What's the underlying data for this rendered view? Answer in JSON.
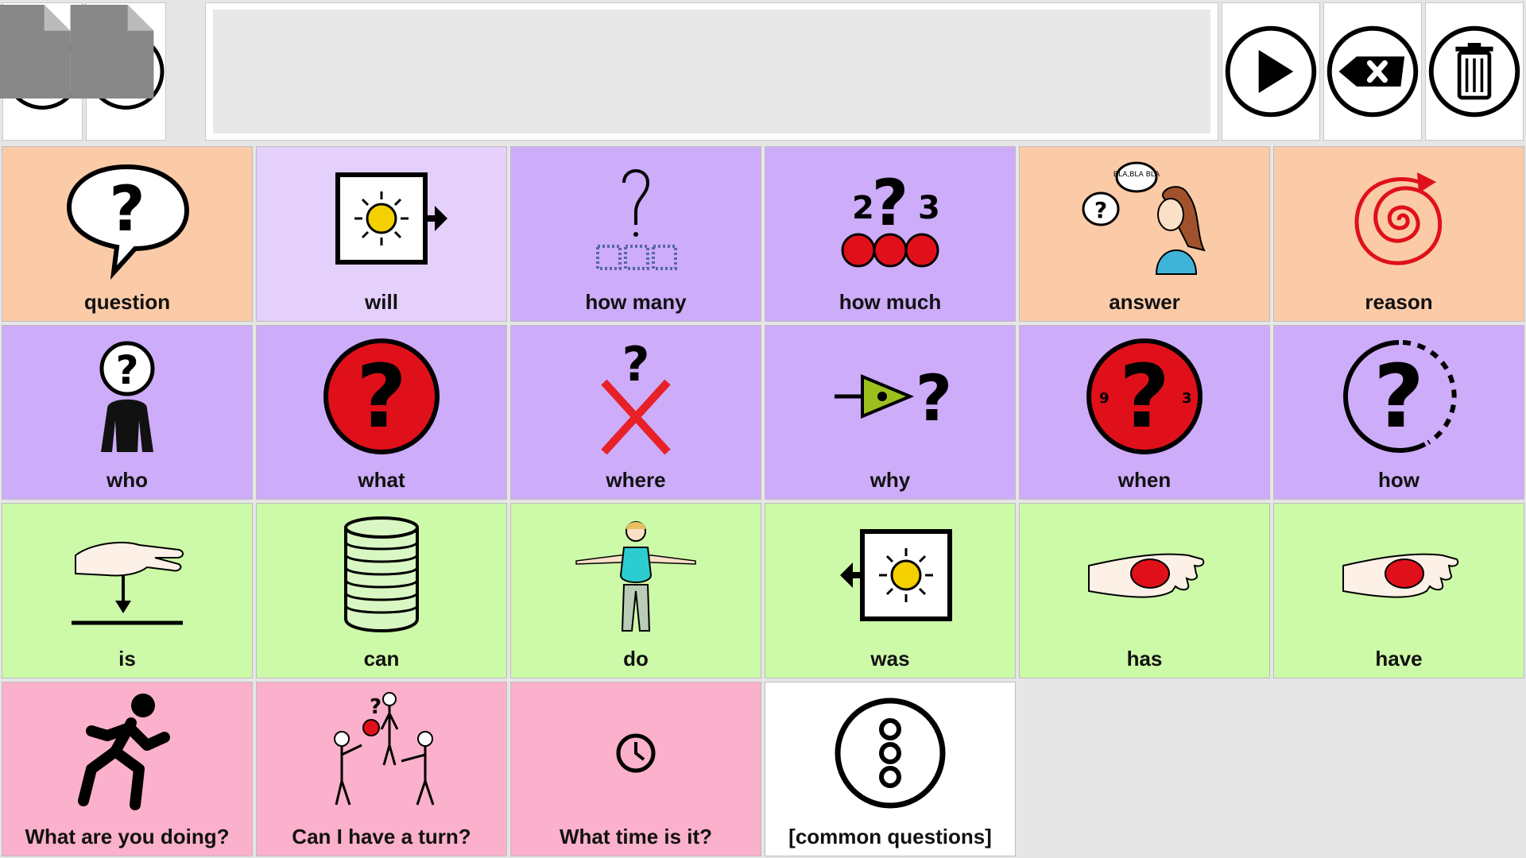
{
  "toolbar": {
    "home_icon": "home-icon",
    "back_icon": "undo-icon",
    "speak_icon": "play-icon",
    "backspace_icon": "backspace-icon",
    "clear_icon": "trash-icon",
    "message_text": ""
  },
  "colors": {
    "peach": "#fbcba8",
    "lavender_light": "#e4d0fb",
    "purple": "#cdacf9",
    "green": "#cdfaa8",
    "pink": "#fbb0cc",
    "white": "#ffffff"
  },
  "cells": [
    {
      "label": "question",
      "icon": "speech-bubble-question-icon",
      "color": "peach"
    },
    {
      "label": "will",
      "icon": "sun-arrow-right-icon",
      "color": "lavender_light"
    },
    {
      "label": "how many",
      "icon": "question-squares-icon",
      "color": "purple"
    },
    {
      "label": "how much",
      "icon": "question-dots-icon",
      "color": "purple"
    },
    {
      "label": "answer",
      "icon": "girl-speaking-icon",
      "color": "peach"
    },
    {
      "label": "reason",
      "icon": "spiral-icon",
      "color": "peach"
    },
    {
      "label": "who",
      "icon": "person-question-icon",
      "color": "purple"
    },
    {
      "label": "what",
      "icon": "red-question-icon",
      "color": "purple"
    },
    {
      "label": "where",
      "icon": "question-cross-icon",
      "color": "purple"
    },
    {
      "label": "why",
      "icon": "triangle-question-icon",
      "color": "purple"
    },
    {
      "label": "when",
      "icon": "clock-question-icon",
      "color": "purple"
    },
    {
      "label": "how",
      "icon": "dashed-circle-question-icon",
      "color": "purple"
    },
    {
      "label": "is",
      "icon": "hand-arrow-down-icon",
      "color": "green"
    },
    {
      "label": "can",
      "icon": "cylinder-can-icon",
      "color": "green"
    },
    {
      "label": "do",
      "icon": "person-arms-out-icon",
      "color": "green"
    },
    {
      "label": "was",
      "icon": "sun-arrow-left-icon",
      "color": "green"
    },
    {
      "label": "has",
      "icon": "hand-ball-icon",
      "color": "green"
    },
    {
      "label": "have",
      "icon": "hand-ball-icon",
      "color": "green"
    },
    {
      "label": "What are you doing?",
      "icon": "running-person-icon",
      "color": "pink"
    },
    {
      "label": "Can I have a turn?",
      "icon": "people-ball-icon",
      "color": "pink"
    },
    {
      "label": "What time is it?",
      "icon": "small-clock-icon",
      "color": "pink"
    },
    {
      "label": "[common questions]",
      "icon": "menu-dots-circle-icon",
      "color": "white"
    }
  ],
  "clock_numbers": {
    "left": "9",
    "right": "3"
  },
  "how_much_numbers": {
    "left": "2",
    "right": "3"
  },
  "answer_bubble_text": "BLA,BLA BLA"
}
